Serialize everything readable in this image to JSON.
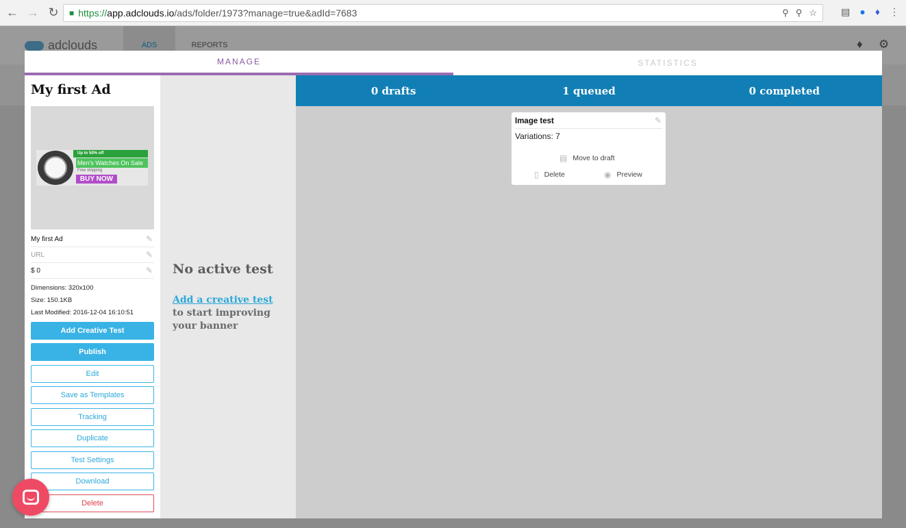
{
  "browser": {
    "url_secure": "https://",
    "url_host": "app.adclouds.io",
    "url_path": "/ads/folder/1973?manage=true&adId=7683"
  },
  "app": {
    "logo_text": "adclouds",
    "tabs": [
      {
        "label": "ADS",
        "active": true
      },
      {
        "label": "REPORTS",
        "active": false
      }
    ]
  },
  "modal": {
    "tabs": [
      {
        "label": "MANAGE",
        "active": true
      },
      {
        "label": "STATISTICS",
        "active": false
      }
    ]
  },
  "ad": {
    "title": "My first Ad",
    "banner": {
      "ribbon": "Up to 50% off",
      "headline": "Men's Watches On Sale",
      "subline": "Free shipping",
      "cta": "BUY NOW"
    },
    "fields": {
      "name": "My first Ad",
      "url_placeholder": "URL",
      "price": "$ 0"
    },
    "meta": {
      "dimensions": "Dimensions: 320x100",
      "size": "Size: 150.1KB",
      "last_modified": "Last Modified: 2016-12-04 16:10:51"
    },
    "buttons": {
      "add_creative_test": "Add Creative Test",
      "publish": "Publish",
      "edit": "Edit",
      "save_as_templates": "Save as Templates",
      "tracking": "Tracking",
      "duplicate": "Duplicate",
      "test_settings": "Test Settings",
      "download": "Download",
      "delete": "Delete"
    }
  },
  "middle": {
    "no_test": "No active test",
    "add_link": "Add a creative test",
    "description": "to start improving your banner"
  },
  "board": {
    "columns": [
      {
        "title": "0 drafts"
      },
      {
        "title": "1 queued"
      },
      {
        "title": "0 completed"
      }
    ],
    "card": {
      "name": "Image test",
      "variations": "Variations: 7",
      "move_to_draft": "Move to draft",
      "delete": "Delete",
      "preview": "Preview"
    }
  },
  "icons": {
    "back": "back-arrow-icon",
    "forward": "forward-arrow-icon",
    "reload": "reload-icon",
    "lock": "lock-icon",
    "bell": "bell-icon",
    "gear": "gear-icon",
    "pencil": "pencil-icon",
    "trash": "trash-icon",
    "eye": "eye-icon",
    "chat": "chat-icon"
  },
  "colors": {
    "accent_blue": "#117fb5",
    "button_blue": "#39b3e5",
    "manage_purple": "#9b6bb1",
    "delete_red": "#e04a58",
    "chat_pink": "#ef4a64"
  }
}
